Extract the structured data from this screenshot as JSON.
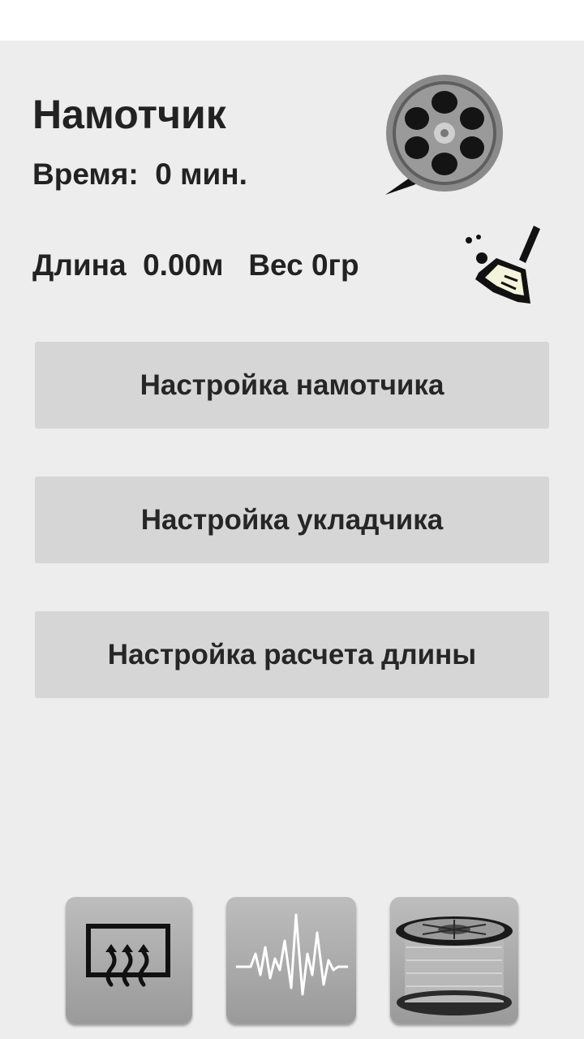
{
  "header": {
    "title": "Намотчик",
    "time_text": "Время:  0 мин.",
    "length_weight_text": "Длина  0.00м   Вес 0гр"
  },
  "buttons": {
    "winder_settings": "Настройка намотчика",
    "layer_settings": "Настройка укладчика",
    "length_calc_settings": "Настройка расчета длины"
  },
  "icons": {
    "reel": "film-reel-icon",
    "clear": "broom-icon",
    "heater": "heater-icon",
    "signal": "waveform-icon",
    "spool": "filament-spool-icon"
  }
}
